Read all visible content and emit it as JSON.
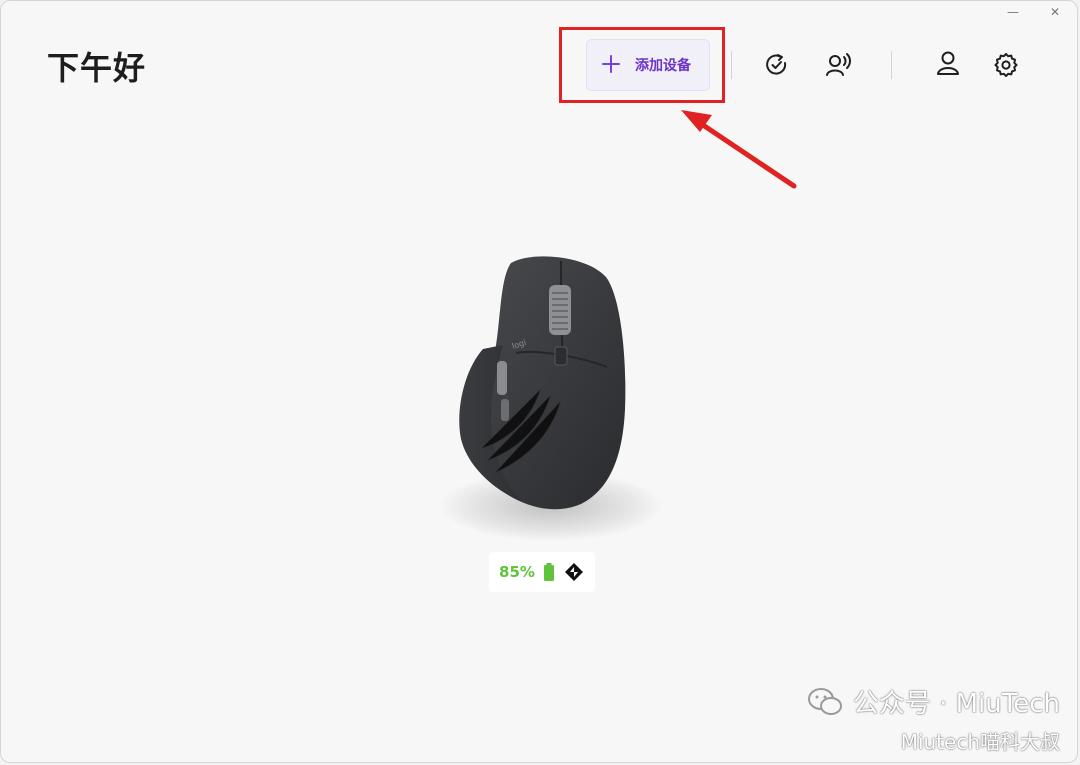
{
  "window": {
    "minimize_glyph": "—",
    "close_glyph": "✕"
  },
  "header": {
    "greeting": "下午好",
    "add_device_icon": "plus-icon",
    "add_device_label": "添加设备",
    "toolbar_icons": [
      "sync-check-icon",
      "voice-icon",
      "account-icon",
      "settings-icon"
    ]
  },
  "annotation": {
    "color": "#e02222"
  },
  "device": {
    "image": "logitech-mx-master-mouse",
    "battery_percent": "85%",
    "battery_color": "#61c23c",
    "connection_icon": "logi-bolt-icon"
  },
  "watermark": {
    "line1": "公众号 · MiuTech",
    "line2": "Miutech喵科大叔"
  },
  "colors": {
    "accent": "#6c34c8",
    "background": "#f7f7f7"
  }
}
